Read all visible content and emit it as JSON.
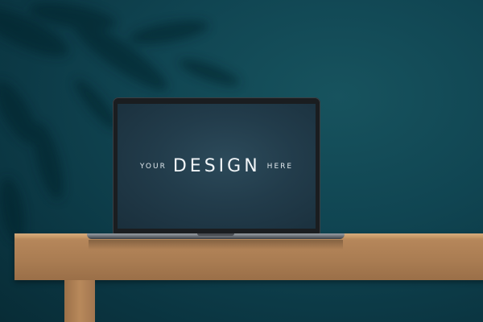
{
  "screen": {
    "small_left": "YOUR",
    "big": "DESIGN",
    "small_right": "HERE"
  },
  "colors": {
    "wall": "#0d3d47",
    "table": "#b5865a",
    "screen": "#223c4b"
  }
}
